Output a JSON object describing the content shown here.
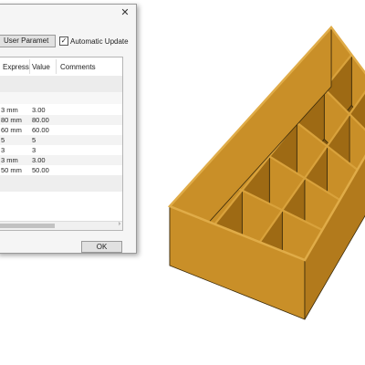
{
  "dialog": {
    "close_glyph": "✕",
    "user_params_label": "User Paramet",
    "auto_update_label": "Automatic Update",
    "auto_update_checked": true,
    "check_glyph": "✓",
    "ok_label": "OK"
  },
  "table": {
    "headers": [
      "Express",
      "Value",
      "Comments"
    ],
    "rows": [
      {
        "expr": "3 mm",
        "value": "3.00"
      },
      {
        "expr": "80 mm",
        "value": "80.00"
      },
      {
        "expr": "60 mm",
        "value": "60.00"
      },
      {
        "expr": "5",
        "value": "5"
      },
      {
        "expr": "3",
        "value": "3"
      },
      {
        "expr": "3 mm",
        "value": "3.00"
      },
      {
        "expr": "50 mm",
        "value": "50.00"
      }
    ],
    "scroll_right_glyph": "›"
  },
  "model": {
    "wall_color": "#c98f28",
    "inner_color": "#9e6a14",
    "shade_color": "#7f5510",
    "edge_color": "#3a2a0a",
    "compartment_rows": 5,
    "compartment_cols": 3
  }
}
